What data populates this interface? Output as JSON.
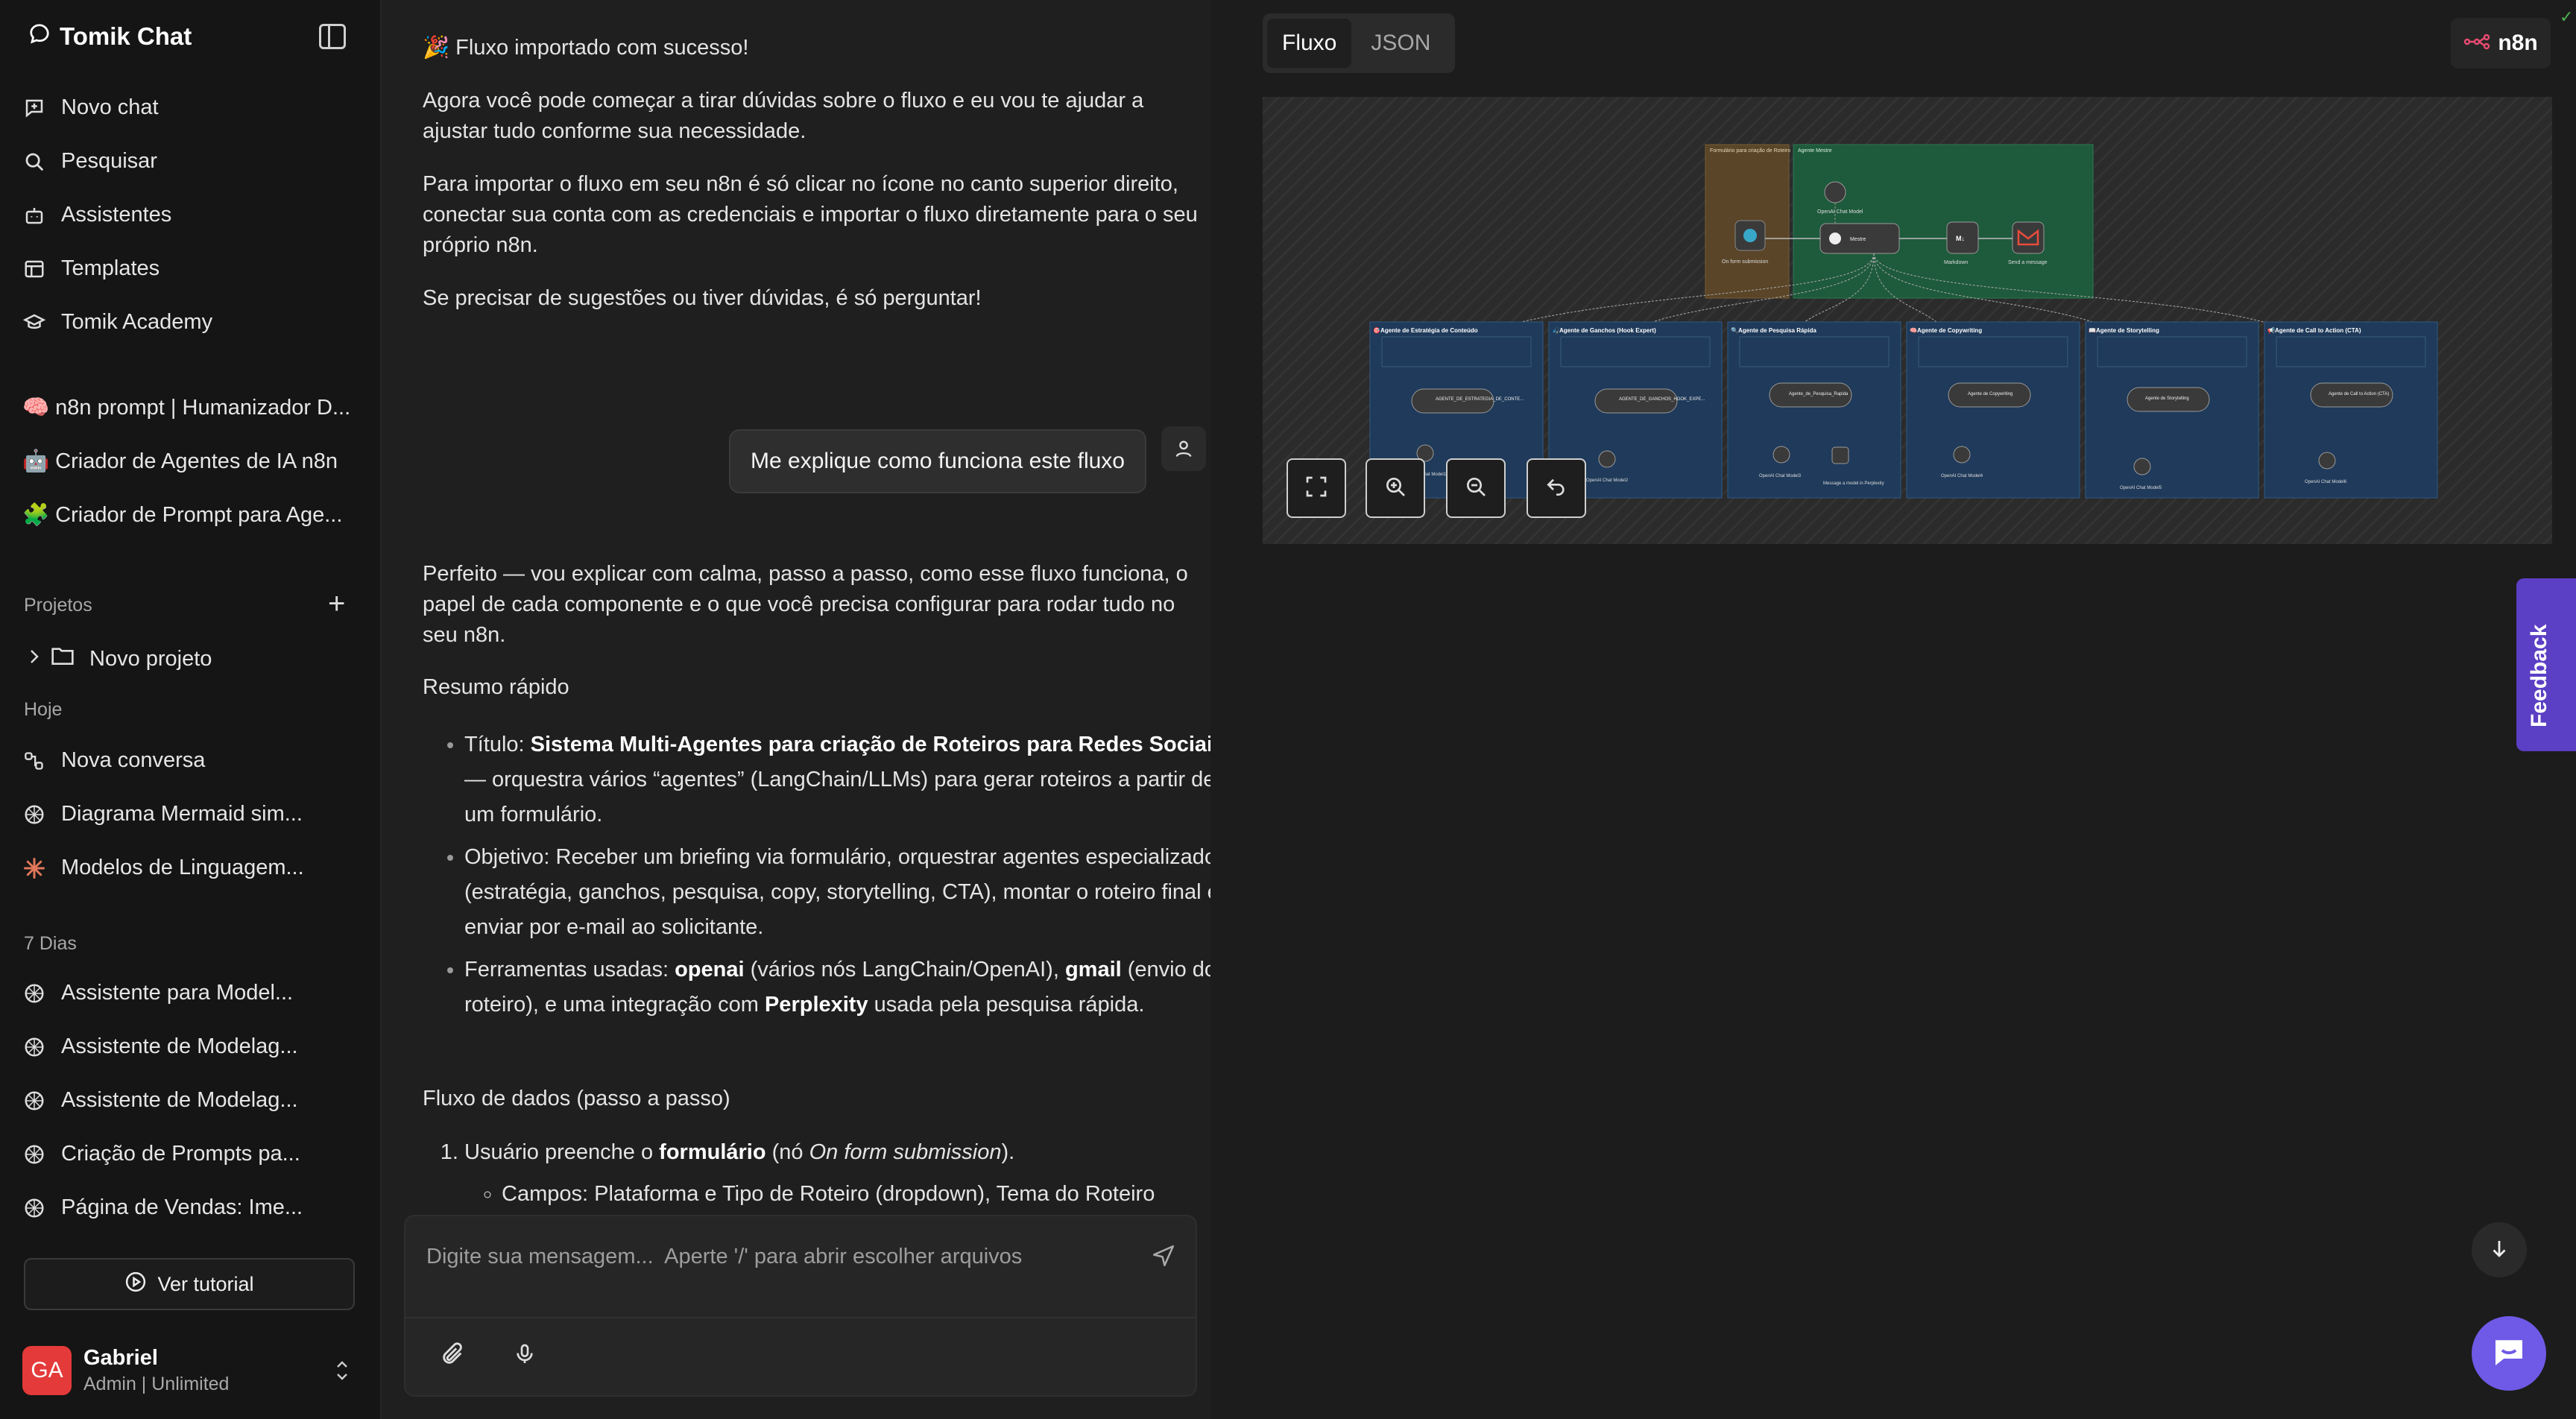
{
  "sidebar": {
    "app_title": "Tomik Chat",
    "nav": [
      {
        "label": "Novo chat",
        "icon": "new-chat-icon"
      },
      {
        "label": "Pesquisar",
        "icon": "search-icon"
      },
      {
        "label": "Assistentes",
        "icon": "robot-icon"
      },
      {
        "label": "Templates",
        "icon": "templates-icon"
      },
      {
        "label": "Tomik Academy",
        "icon": "graduation-cap-icon"
      }
    ],
    "pinned": [
      {
        "label": "🧠 n8n prompt | Humanizador D..."
      },
      {
        "label": "🤖 Criador de Agentes de IA n8n"
      },
      {
        "label": "🧩 Criador de Prompt para Age..."
      }
    ],
    "projects_title": "Projetos",
    "project_name": "Novo projeto",
    "today_title": "Hoje",
    "today": [
      {
        "label": "Nova conversa",
        "icon": "flow-icon"
      },
      {
        "label": "Diagrama Mermaid sim...",
        "icon": "openai-icon"
      },
      {
        "label": "Modelos de Linguagem...",
        "icon": "claude-icon"
      }
    ],
    "week_title": "7 Dias",
    "week": [
      {
        "label": "Assistente para Model...",
        "icon": "openai-icon"
      },
      {
        "label": "Assistente de Modelag...",
        "icon": "openai-icon"
      },
      {
        "label": "Assistente de Modelag...",
        "icon": "openai-icon"
      },
      {
        "label": "Criação de Prompts pa...",
        "icon": "openai-icon"
      },
      {
        "label": "Página de Vendas: Ime...",
        "icon": "openai-icon"
      }
    ],
    "tutorial_label": "Ver tutorial",
    "user": {
      "initials": "GA",
      "name": "Gabriel",
      "plan": "Admin | Unlimited"
    }
  },
  "chat": {
    "bot_intro": {
      "p1": "🎉 Fluxo importado com sucesso!",
      "p2": "Agora você pode começar a tirar dúvidas sobre o fluxo e eu vou te ajudar a ajustar tudo conforme sua necessidade.",
      "p3": "Para importar o fluxo em seu n8n é só clicar no ícone no canto superior direito, conectar sua conta com as credenciais e importar o fluxo diretamente para o seu próprio n8n.",
      "p4": "Se precisar de sugestões ou tiver dúvidas, é só perguntar!"
    },
    "user_message": "Me explique como funciona este fluxo",
    "answer": {
      "intro": "Perfeito — vou explicar com calma, passo a passo, como esse fluxo funciona, o papel de cada componente e o que você precisa configurar para rodar tudo no seu n8n.",
      "summary_title": "Resumo rápido",
      "b1_prefix": "Título: ",
      "b1_bold": "Sistema Multi-Agentes para criação de Roteiros para Redes Sociais",
      "b1_rest": " — orquestra vários “agentes” (LangChain/LLMs) para gerar roteiros a partir de um formulário.",
      "b2": "Objetivo: Receber um briefing via formulário, orquestrar agentes especializados (estratégia, ganchos, pesquisa, copy, storytelling, CTA), montar o roteiro final e enviar por e-mail ao solicitante.",
      "b3_prefix": "Ferramentas usadas: ",
      "b3_bold1": "openai",
      "b3_mid1": " (vários nós LangChain/OpenAI), ",
      "b3_bold2": "gmail",
      "b3_mid2": " (envio do roteiro), e uma integração com ",
      "b3_bold3": "Perplexity",
      "b3_end": " usada pela pesquisa rápida.",
      "flow_title": "Fluxo de dados (passo a passo)",
      "s1_prefix": "Usuário preenche o ",
      "s1_bold": "formulário",
      "s1_mid": " (nó ",
      "s1_italic": "On form submission",
      "s1_end": ").",
      "s1_sub": "Campos: Plataforma e Tipo de Roteiro (dropdown), Tema do Roteiro"
    },
    "composer_placeholder": "Digite sua mensagem...  Aperte '/' para abrir escolher arquivos"
  },
  "panel": {
    "tabs": [
      {
        "label": "Fluxo"
      },
      {
        "label": "JSON"
      }
    ],
    "n8n_label": "n8n",
    "feedback_label": "Feedback",
    "flow": {
      "form_group": "Formulário para criação de Roteiro",
      "master_group": "Agente Mestre",
      "form_trigger": "On form submission",
      "master_node": "Mestre",
      "master_model": "OpenAI Chat Model",
      "markdown_node": "Markdown",
      "gmail_node": "Send a message",
      "agents": [
        {
          "title": "🎯Agente de Estratégia de Conteúdo",
          "node": "AGENTE_DE_ESTRATEGIA_DE_CONTE...",
          "model": "OpenAI Chat Model1"
        },
        {
          "title": "🎣Agente de Ganchos (Hook Expert)",
          "node": "AGENTE_DE_GANCHOS_HOOK_EXPE...",
          "model": "OpenAI Chat Model2"
        },
        {
          "title": "🔍Agente de Pesquisa Rápida",
          "node": "Agente_de_Pesquisa_Rapida",
          "model": "OpenAI Chat Model3",
          "extra": "Message a model in Perplexity"
        },
        {
          "title": "🧠Agente de Copywriting",
          "node": "Agente de Copywriting",
          "model": "OpenAI Chat Model4"
        },
        {
          "title": "📖Agente de Storytelling",
          "node": "Agente de Storytelling",
          "model": "OpenAI Chat Model5"
        },
        {
          "title": "📢Agente de Call to Action (CTA)",
          "node": "Agente de Call to Action (CTA)",
          "model": "OpenAI Chat Model6"
        }
      ]
    }
  }
}
